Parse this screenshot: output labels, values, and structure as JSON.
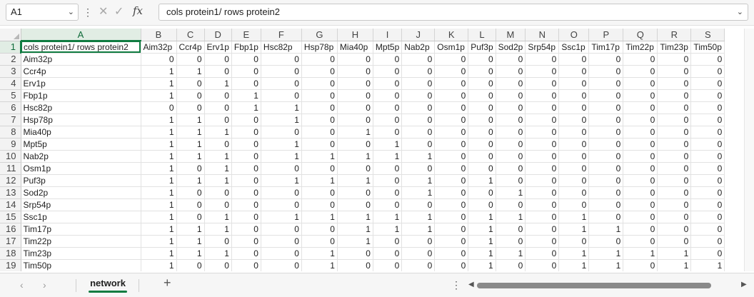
{
  "formula_bar": {
    "name_box": "A1",
    "formula": "cols protein1/ rows protein2"
  },
  "icons": {
    "name_box_dropdown": "chevron-down-icon",
    "more": "vertical-dots-icon",
    "cancel": "x-icon",
    "enter": "check-icon",
    "function": "fx-icon",
    "expand_formula": "chevron-down-icon"
  },
  "grid": {
    "selected_cell": "A1",
    "columns": [
      "A",
      "B",
      "C",
      "D",
      "E",
      "F",
      "G",
      "H",
      "I",
      "J",
      "K",
      "L",
      "M",
      "N",
      "O",
      "P",
      "Q",
      "R",
      "S"
    ],
    "rows": [
      {
        "n": "1",
        "cells": [
          "cols protein1/ rows protein2",
          "Aim32p",
          "Ccr4p",
          "Erv1p",
          "Fbp1p",
          "Hsc82p",
          "Hsp78p",
          "Mia40p",
          "Mpt5p",
          "Nab2p",
          "Osm1p",
          "Puf3p",
          "Sod2p",
          "Srp54p",
          "Ssc1p",
          "Tim17p",
          "Tim22p",
          "Tim23p",
          "Tim50p"
        ]
      },
      {
        "n": "2",
        "cells": [
          "Aim32p",
          "0",
          "0",
          "0",
          "0",
          "0",
          "0",
          "0",
          "0",
          "0",
          "0",
          "0",
          "0",
          "0",
          "0",
          "0",
          "0",
          "0",
          "0"
        ]
      },
      {
        "n": "3",
        "cells": [
          "Ccr4p",
          "1",
          "1",
          "0",
          "0",
          "0",
          "0",
          "0",
          "0",
          "0",
          "0",
          "0",
          "0",
          "0",
          "0",
          "0",
          "0",
          "0",
          "0"
        ]
      },
      {
        "n": "4",
        "cells": [
          "Erv1p",
          "1",
          "0",
          "1",
          "0",
          "0",
          "0",
          "0",
          "0",
          "0",
          "0",
          "0",
          "0",
          "0",
          "0",
          "0",
          "0",
          "0",
          "0"
        ]
      },
      {
        "n": "5",
        "cells": [
          "Fbp1p",
          "1",
          "0",
          "0",
          "1",
          "0",
          "0",
          "0",
          "0",
          "0",
          "0",
          "0",
          "0",
          "0",
          "0",
          "0",
          "0",
          "0",
          "0"
        ]
      },
      {
        "n": "6",
        "cells": [
          "Hsc82p",
          "0",
          "0",
          "0",
          "1",
          "1",
          "0",
          "0",
          "0",
          "0",
          "0",
          "0",
          "0",
          "0",
          "0",
          "0",
          "0",
          "0",
          "0"
        ]
      },
      {
        "n": "7",
        "cells": [
          "Hsp78p",
          "1",
          "1",
          "0",
          "0",
          "1",
          "0",
          "0",
          "0",
          "0",
          "0",
          "0",
          "0",
          "0",
          "0",
          "0",
          "0",
          "0",
          "0"
        ]
      },
      {
        "n": "8",
        "cells": [
          "Mia40p",
          "1",
          "1",
          "1",
          "0",
          "0",
          "0",
          "1",
          "0",
          "0",
          "0",
          "0",
          "0",
          "0",
          "0",
          "0",
          "0",
          "0",
          "0"
        ]
      },
      {
        "n": "9",
        "cells": [
          "Mpt5p",
          "1",
          "1",
          "0",
          "0",
          "1",
          "0",
          "0",
          "1",
          "0",
          "0",
          "0",
          "0",
          "0",
          "0",
          "0",
          "0",
          "0",
          "0"
        ]
      },
      {
        "n": "10",
        "cells": [
          "Nab2p",
          "1",
          "1",
          "1",
          "0",
          "1",
          "1",
          "1",
          "1",
          "1",
          "0",
          "0",
          "0",
          "0",
          "0",
          "0",
          "0",
          "0",
          "0"
        ]
      },
      {
        "n": "11",
        "cells": [
          "Osm1p",
          "1",
          "0",
          "1",
          "0",
          "0",
          "0",
          "0",
          "0",
          "0",
          "0",
          "0",
          "0",
          "0",
          "0",
          "0",
          "0",
          "0",
          "0"
        ]
      },
      {
        "n": "12",
        "cells": [
          "Puf3p",
          "1",
          "1",
          "1",
          "0",
          "1",
          "1",
          "1",
          "0",
          "1",
          "0",
          "1",
          "0",
          "0",
          "0",
          "0",
          "0",
          "0",
          "0"
        ]
      },
      {
        "n": "13",
        "cells": [
          "Sod2p",
          "1",
          "0",
          "0",
          "0",
          "0",
          "0",
          "0",
          "0",
          "1",
          "0",
          "0",
          "1",
          "0",
          "0",
          "0",
          "0",
          "0",
          "0"
        ]
      },
      {
        "n": "14",
        "cells": [
          "Srp54p",
          "1",
          "0",
          "0",
          "0",
          "0",
          "0",
          "0",
          "0",
          "0",
          "0",
          "0",
          "0",
          "0",
          "0",
          "0",
          "0",
          "0",
          "0"
        ]
      },
      {
        "n": "15",
        "cells": [
          "Ssc1p",
          "1",
          "0",
          "1",
          "0",
          "1",
          "1",
          "1",
          "1",
          "1",
          "0",
          "1",
          "1",
          "0",
          "1",
          "0",
          "0",
          "0",
          "0"
        ]
      },
      {
        "n": "16",
        "cells": [
          "Tim17p",
          "1",
          "1",
          "1",
          "0",
          "0",
          "0",
          "1",
          "1",
          "1",
          "0",
          "1",
          "0",
          "0",
          "1",
          "1",
          "0",
          "0",
          "0"
        ]
      },
      {
        "n": "17",
        "cells": [
          "Tim22p",
          "1",
          "1",
          "0",
          "0",
          "0",
          "0",
          "1",
          "0",
          "0",
          "0",
          "1",
          "0",
          "0",
          "0",
          "0",
          "0",
          "0",
          "0"
        ]
      },
      {
        "n": "18",
        "cells": [
          "Tim23p",
          "1",
          "1",
          "1",
          "0",
          "0",
          "1",
          "0",
          "0",
          "0",
          "0",
          "1",
          "1",
          "0",
          "1",
          "1",
          "1",
          "1",
          "0"
        ]
      },
      {
        "n": "19",
        "cells": [
          "Tim50p",
          "1",
          "0",
          "0",
          "0",
          "0",
          "1",
          "0",
          "0",
          "0",
          "0",
          "1",
          "0",
          "0",
          "1",
          "1",
          "0",
          "1",
          "1"
        ]
      }
    ]
  },
  "sheet_tabs": {
    "prev": "‹",
    "next": "›",
    "tabs": [
      "network"
    ],
    "active": "network",
    "add": "+",
    "more": "⋮"
  },
  "colors": {
    "accent": "#107c41",
    "header_active_bg": "#e1ede4"
  }
}
